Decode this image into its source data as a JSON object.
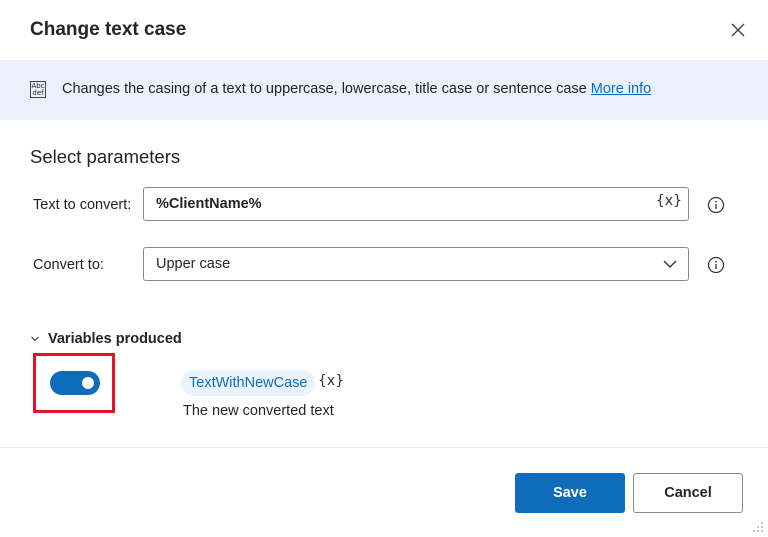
{
  "dialog": {
    "title": "Change text case"
  },
  "banner": {
    "icon": "abc-def-icon",
    "icon_text_top": "Abc",
    "icon_text_bottom": "def",
    "description": "Changes the casing of a text to uppercase, lowercase, title case or sentence case",
    "link_label": "More info"
  },
  "parameters": {
    "section_title": "Select parameters",
    "text_to_convert": {
      "label": "Text to convert:",
      "value": "%ClientName%",
      "var_button": "{x}"
    },
    "convert_to": {
      "label": "Convert to:",
      "selected": "Upper case"
    }
  },
  "variables": {
    "header": "Variables produced",
    "toggle_on": true,
    "name": "TextWithNewCase",
    "var_button": "{x}",
    "description": "The new converted text"
  },
  "footer": {
    "save_label": "Save",
    "cancel_label": "Cancel"
  },
  "colors": {
    "accent": "#0f6cbd",
    "banner_bg": "#eaf1fb",
    "highlight": "#e81123"
  }
}
